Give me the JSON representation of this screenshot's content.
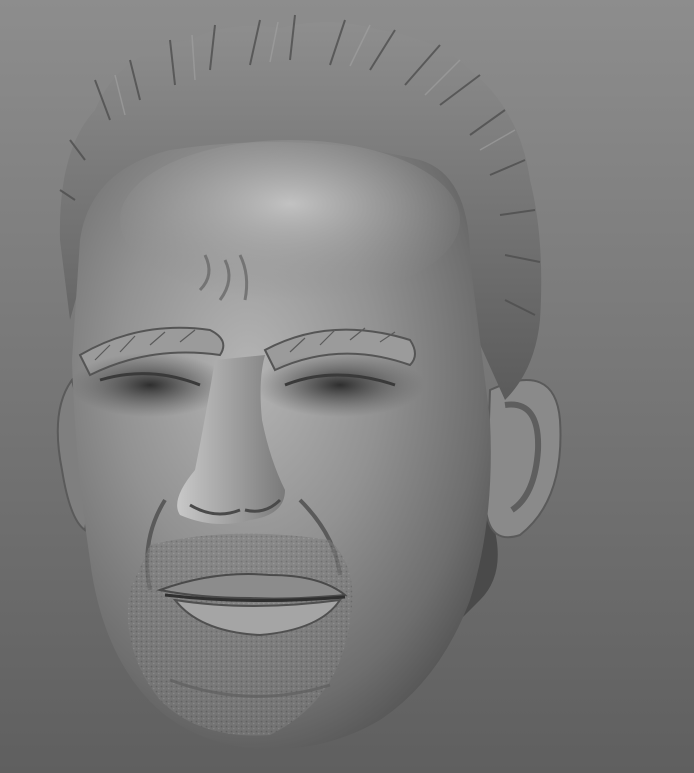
{
  "scene": {
    "subject": "sculpted-head",
    "material_color": "#8a8a8a",
    "background_top": "#8d8d8d",
    "background_bottom": "#5f5f5f"
  }
}
